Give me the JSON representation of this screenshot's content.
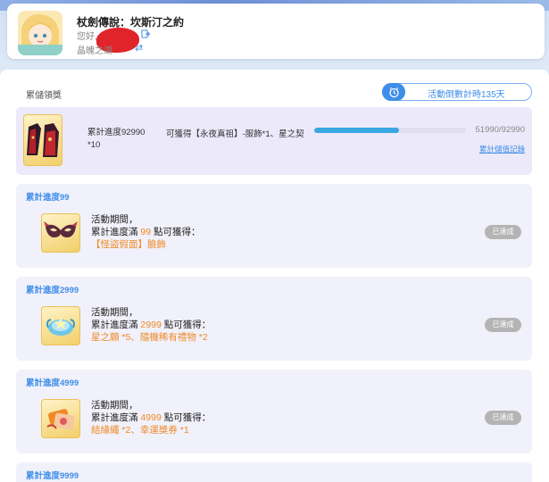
{
  "header": {
    "game_title": "杖劍傳說：坎斯汀之約",
    "greeting": "您好,",
    "server_name": "晶魄之湖"
  },
  "section": {
    "title": "累儲領獎",
    "countdown": "活動倒數計時135天"
  },
  "summary": {
    "progress_label": "累計進度92990",
    "progress_count": "*10",
    "reward_text": "可獲得【永夜真祖】-服飾*1、星之契",
    "progress_current": 51990,
    "progress_total": 92990,
    "progress_text": "51990/92990",
    "record_link": "累計儲值記錄"
  },
  "tiers": [
    {
      "title": "累計進度99",
      "line1": "活動期間，",
      "line2_prefix": "累計進度滿 ",
      "threshold": "99",
      "line2_suffix": " 點可獲得：",
      "reward": "【怪盜假面】臉飾",
      "status": "已達成",
      "icon": "mask-icon"
    },
    {
      "title": "累計進度2999",
      "line1": "活動期間，",
      "line2_prefix": "累計進度滿 ",
      "threshold": "2999",
      "line2_suffix": " 點可獲得：",
      "reward": "星之願 *5、隨機稀有禮物 *2",
      "status": "已達成",
      "icon": "star-wish-icon"
    },
    {
      "title": "累計進度4999",
      "line1": "活動期間，",
      "line2_prefix": "累計進度滿 ",
      "threshold": "4999",
      "line2_suffix": " 點可獲得：",
      "reward": "結緣繩 *2、幸運獎券 *1",
      "status": "已達成",
      "icon": "ticket-icon"
    },
    {
      "title": "累計進度9999"
    }
  ],
  "colors": {
    "accent": "#3f8ee8",
    "highlight": "#f08a24",
    "status_done": "#b4b4b4"
  }
}
